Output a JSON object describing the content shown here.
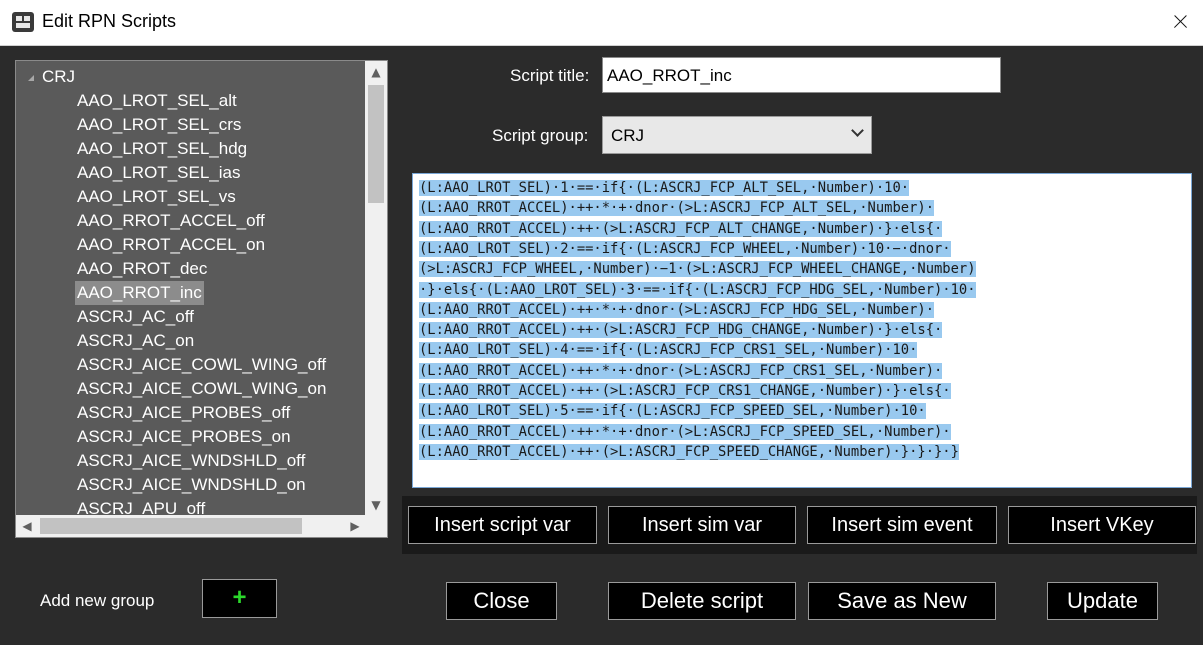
{
  "window": {
    "title": "Edit RPN Scripts",
    "close_glyph": "close-icon"
  },
  "tree": {
    "root_label": "CRJ",
    "items": [
      "AAO_LROT_SEL_alt",
      "AAO_LROT_SEL_crs",
      "AAO_LROT_SEL_hdg",
      "AAO_LROT_SEL_ias",
      "AAO_LROT_SEL_vs",
      "AAO_RROT_ACCEL_off",
      "AAO_RROT_ACCEL_on",
      "AAO_RROT_dec",
      "AAO_RROT_inc",
      "ASCRJ_AC_off",
      "ASCRJ_AC_on",
      "ASCRJ_AICE_COWL_WING_off",
      "ASCRJ_AICE_COWL_WING_on",
      "ASCRJ_AICE_PROBES_off",
      "ASCRJ_AICE_PROBES_on",
      "ASCRJ_AICE_WNDSHLD_off",
      "ASCRJ_AICE_WNDSHLD_on",
      "ASCRJ_APU_off"
    ],
    "selected_index": 8
  },
  "form": {
    "script_title_label": "Script title:",
    "script_title_value": "AAO_RROT_inc",
    "script_group_label": "Script group:",
    "script_group_value": "CRJ"
  },
  "script": {
    "lines": [
      "(L:AAO_LROT_SEL)·1·==·if{·(L:ASCRJ_FCP_ALT_SEL,·Number)·10·",
      "(L:AAO_RROT_ACCEL)·++·*·+·dnor·(>L:ASCRJ_FCP_ALT_SEL,·Number)·",
      "(L:AAO_RROT_ACCEL)·++·(>L:ASCRJ_FCP_ALT_CHANGE,·Number)·}·els{·",
      "(L:AAO_LROT_SEL)·2·==·if{·(L:ASCRJ_FCP_WHEEL,·Number)·10·−·dnor·",
      "(>L:ASCRJ_FCP_WHEEL,·Number)·−1·(>L:ASCRJ_FCP_WHEEL_CHANGE,·Number)",
      "·}·els{·(L:AAO_LROT_SEL)·3·==·if{·(L:ASCRJ_FCP_HDG_SEL,·Number)·10·",
      "(L:AAO_RROT_ACCEL)·++·*·+·dnor·(>L:ASCRJ_FCP_HDG_SEL,·Number)·",
      "(L:AAO_RROT_ACCEL)·++·(>L:ASCRJ_FCP_HDG_CHANGE,·Number)·}·els{·",
      "(L:AAO_LROT_SEL)·4·==·if{·(L:ASCRJ_FCP_CRS1_SEL,·Number)·10·",
      "(L:AAO_RROT_ACCEL)·++·*·+·dnor·(>L:ASCRJ_FCP_CRS1_SEL,·Number)·",
      "(L:AAO_RROT_ACCEL)·++·(>L:ASCRJ_FCP_CRS1_CHANGE,·Number)·}·els{·",
      "(L:AAO_LROT_SEL)·5·==·if{·(L:ASCRJ_FCP_SPEED_SEL,·Number)·10·",
      "(L:AAO_RROT_ACCEL)·++·*·+·dnor·(>L:ASCRJ_FCP_SPEED_SEL,·Number)·",
      "(L:AAO_RROT_ACCEL)·++·(>L:ASCRJ_FCP_SPEED_CHANGE,·Number)·}·}·}·}"
    ]
  },
  "insert_buttons": {
    "script_var": "Insert script var",
    "sim_var": "Insert sim var",
    "sim_event": "Insert sim event",
    "vkey": "Insert VKey"
  },
  "footer": {
    "add_group_label": "Add new group",
    "plus_label": "+",
    "close": "Close",
    "delete": "Delete script",
    "save_as_new": "Save as New",
    "update": "Update"
  },
  "colors": {
    "background": "#2b2b2b",
    "tree_bg": "#5a5a5a",
    "selection": "#99c9ef",
    "plus": "#2bd82b"
  }
}
